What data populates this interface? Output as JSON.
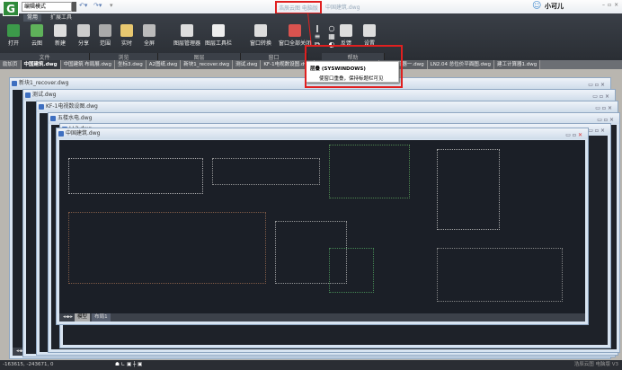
{
  "app": {
    "logo": "G",
    "mode": "编辑模式",
    "doc_title_highlight": "浩辰云图 电脑版",
    "doc_title": "中国建筑.dwg",
    "user": "小可儿",
    "window_controls": "–▫×"
  },
  "ribbon": {
    "tabs": [
      "常用",
      "扩展工具"
    ],
    "buttons": [
      {
        "label": "打开",
        "color": "#3c9a4a"
      },
      {
        "label": "云图",
        "color": "#5fb25a"
      },
      {
        "label": "新建",
        "color": "#ddd"
      },
      {
        "label": "分享",
        "color": "#ccc"
      },
      {
        "label": "范围",
        "color": "#aaa"
      },
      {
        "label": "实时",
        "color": "#e8c870"
      },
      {
        "label": "全屏",
        "color": "#bbb"
      },
      {
        "label": "图层管理器",
        "color": "#ddd"
      },
      {
        "label": "图层工具栏",
        "color": "#eee"
      },
      {
        "label": "窗口转换",
        "color": "#ddd"
      },
      {
        "label": "窗口全部关闭",
        "color": "#d9534f"
      },
      {
        "label": "反馈",
        "color": "#ddd"
      },
      {
        "label": "设置",
        "color": "#ddd"
      }
    ],
    "groups": [
      "文件",
      "浏览",
      "图层",
      "窗口",
      "帮助"
    ]
  },
  "doc_tabs": [
    "励加页",
    "中国建筑.dwg",
    "中国建筑 布局展.dwg",
    "坐标3.dwg",
    "A2图纸.dwg",
    "新块1_recover.dwg",
    "测试.dwg",
    "KF-1电视数设图.dwg",
    "五楼水电.dwg",
    "LL2.dwg",
    "建工计算器一.dwg",
    "LN2.04 总位价平面图.dwg",
    "建工计算器1.dwg"
  ],
  "windows": [
    "新块1_recover.dwg",
    "测试.dwg",
    "KF-1电视数设图.dwg",
    "五楼水电.dwg",
    "LL2.dwg",
    "中国建筑.dwg"
  ],
  "layout_tabs": {
    "model": "模型",
    "layout1": "布局1",
    "layout2": "布局2"
  },
  "tooltip": {
    "title": "层叠 (SYSWINDOWS)",
    "desc": "使窗口重叠，保持标题栏可见"
  },
  "status": {
    "coords": "-163615, -243671, 0",
    "product": "浩辰云图 电脑版 V3"
  }
}
